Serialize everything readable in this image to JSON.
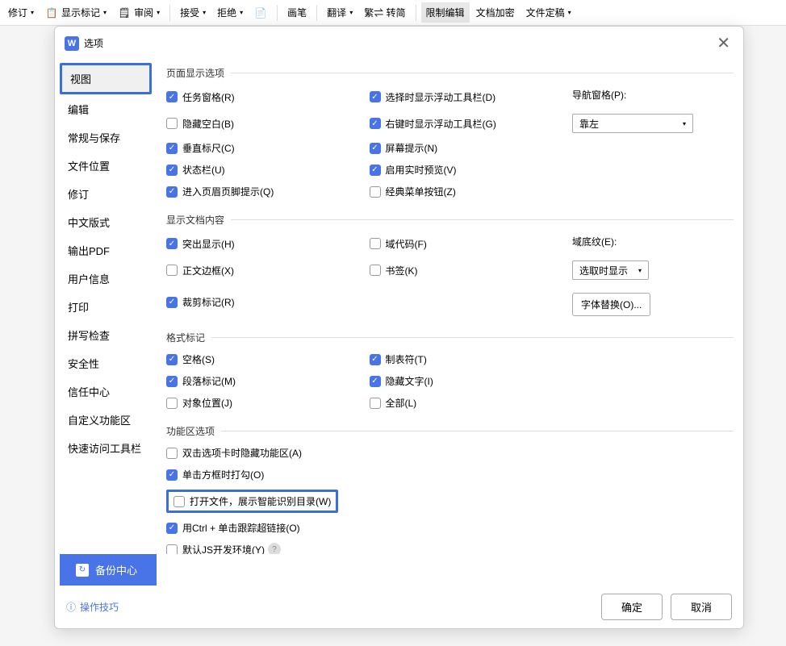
{
  "ribbon": {
    "revision": "修订",
    "show_marks": "显示标记",
    "review": "审阅",
    "accept": "接受",
    "reject": "拒绝",
    "brush": "画笔",
    "translate": "翻译",
    "convert": "繁⇌ 转简",
    "restrict_edit": "限制编辑",
    "doc_encrypt": "文档加密",
    "doc_finalize": "文件定稿"
  },
  "dialog": {
    "title": "选项"
  },
  "sidebar": {
    "items": [
      "视图",
      "编辑",
      "常规与保存",
      "文件位置",
      "修订",
      "中文版式",
      "输出PDF",
      "用户信息",
      "打印",
      "拼写检查",
      "安全性",
      "信任中心",
      "自定义功能区",
      "快速访问工具栏"
    ]
  },
  "sections": {
    "page_display": {
      "title": "页面显示选项",
      "task_pane": "任务窗格(R)",
      "hide_blank": "隐藏空白(B)",
      "vertical_ruler": "垂直标尺(C)",
      "status_bar": "状态栏(U)",
      "header_footer_tip": "进入页眉页脚提示(Q)",
      "select_float_toolbar": "选择时显示浮动工具栏(D)",
      "rightclick_float_toolbar": "右键时显示浮动工具栏(G)",
      "screen_tip": "屏幕提示(N)",
      "enable_realtime_preview": "启用实时预览(V)",
      "classic_menu_button": "经典菜单按钮(Z)",
      "nav_pane_label": "导航窗格(P):",
      "nav_pane_value": "靠左"
    },
    "doc_content": {
      "title": "显示文档内容",
      "highlight": "突出显示(H)",
      "body_border": "正文边框(X)",
      "crop_marks": "裁剪标记(R)",
      "field_code": "域代码(F)",
      "bookmark": "书签(K)",
      "field_shading_label": "域底纹(E):",
      "field_shading_value": "选取时显示",
      "font_replace": "字体替换(O)..."
    },
    "format_marks": {
      "title": "格式标记",
      "space": "空格(S)",
      "paragraph_mark": "段落标记(M)",
      "object_position": "对象位置(J)",
      "tab": "制表符(T)",
      "hidden_text": "隐藏文字(I)",
      "all": "全部(L)"
    },
    "ribbon_options": {
      "title": "功能区选项",
      "dblclick_hide": "双击选项卡时隐藏功能区(A)",
      "click_box_check": "单击方框时打勾(O)",
      "open_file_smart_toc": "打开文件，展示智能识别目录(W)",
      "ctrl_click_hyperlink": "用Ctrl + 单击跟踪超链接(O)",
      "default_js_dev": "默认JS开发环境(Y)"
    }
  },
  "backup_center": "备份中心",
  "tip_link": "操作技巧",
  "buttons": {
    "ok": "确定",
    "cancel": "取消"
  }
}
